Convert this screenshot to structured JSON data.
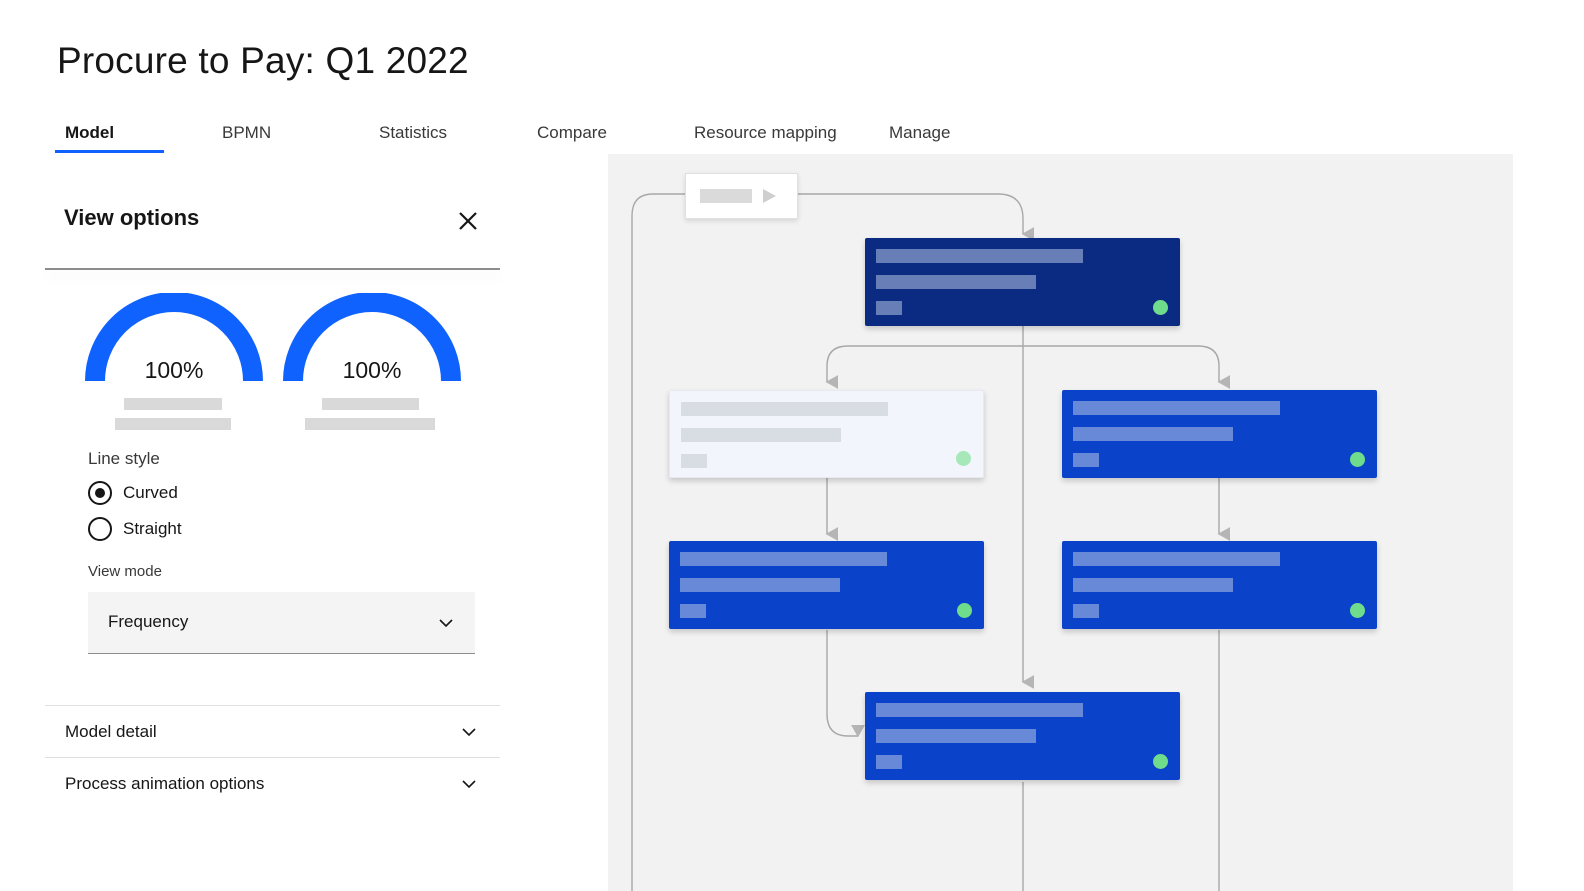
{
  "page": {
    "title": "Procure to Pay: Q1 2022"
  },
  "tabs": [
    {
      "label": "Model",
      "active": true
    },
    {
      "label": "BPMN",
      "active": false
    },
    {
      "label": "Statistics",
      "active": false
    },
    {
      "label": "Compare",
      "active": false
    },
    {
      "label": "Resource mapping",
      "active": false
    },
    {
      "label": "Manage",
      "active": false
    }
  ],
  "view_options": {
    "heading": "View options",
    "close_icon": "close-icon",
    "gauges": [
      {
        "value_label": "100%",
        "value": 1.0
      },
      {
        "value_label": "100%",
        "value": 1.0
      }
    ],
    "line_style": {
      "label": "Line style",
      "options": [
        {
          "label": "Curved",
          "checked": true
        },
        {
          "label": "Straight",
          "checked": false
        }
      ]
    },
    "view_mode": {
      "label": "View mode",
      "selected": "Frequency",
      "chevron_icon": "chevron-down-icon"
    },
    "accordions": [
      {
        "title": "Model detail",
        "icon": "chevron-down-icon"
      },
      {
        "title": "Process animation options",
        "icon": "chevron-down-icon"
      }
    ]
  },
  "colors": {
    "accent": "#0f62fe",
    "node_dark": "#0b2b82",
    "node_blue": "#0a43c9",
    "status_dot": "#6fdc8c",
    "canvas_bg": "#f2f2f2"
  },
  "process_map": {
    "start_node": {
      "icon": "play-icon"
    },
    "nodes": [
      {
        "style": "dark",
        "status": "green"
      },
      {
        "style": "light",
        "status": "green"
      },
      {
        "style": "blue",
        "status": "green"
      },
      {
        "style": "blue",
        "status": "green"
      },
      {
        "style": "blue",
        "status": "green"
      },
      {
        "style": "blue",
        "status": "green"
      }
    ]
  }
}
